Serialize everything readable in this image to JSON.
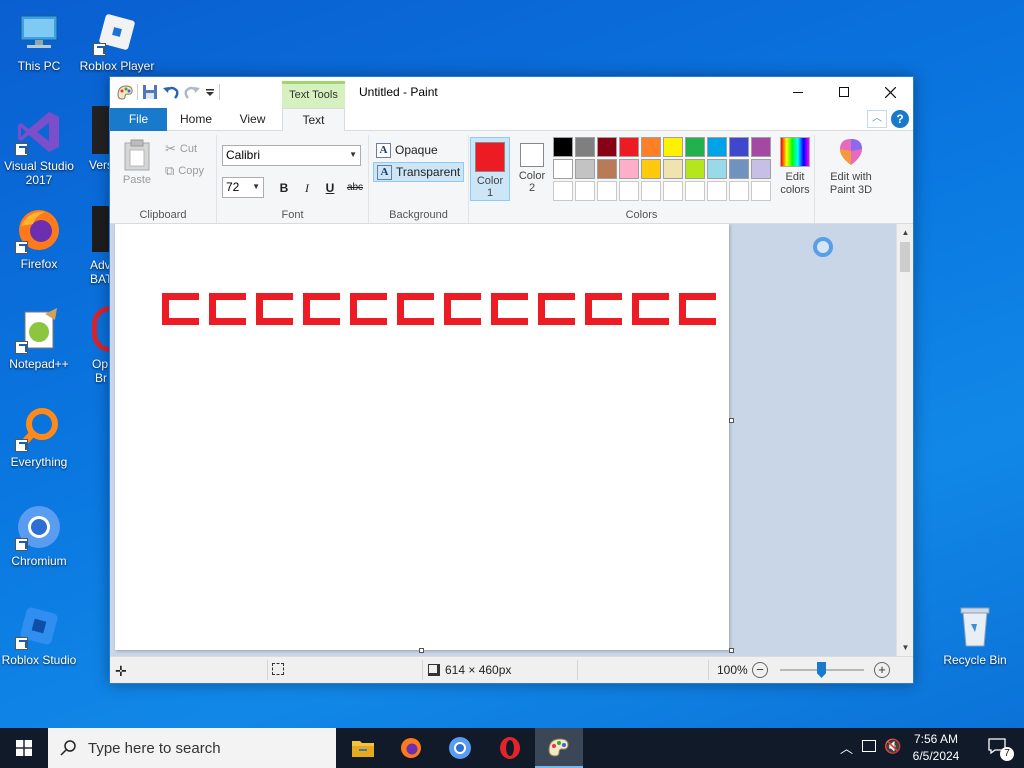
{
  "desktop": {
    "icons": [
      {
        "label": "This PC"
      },
      {
        "label": "Roblox Player"
      },
      {
        "label": "Visual Studio 2017"
      },
      {
        "label": "Firefox"
      },
      {
        "label": "Notepad++"
      },
      {
        "label": "Everything"
      },
      {
        "label": "Chromium"
      },
      {
        "label": "Roblox Studio"
      },
      {
        "label": "Recycle Bin"
      }
    ],
    "partial_labels": [
      "Vers",
      "Adv",
      "BAT",
      "Op",
      "Br"
    ]
  },
  "paint": {
    "title": "Untitled - Paint",
    "context_tab_group": "Text Tools",
    "tabs": {
      "file": "File",
      "home": "Home",
      "view": "View",
      "text": "Text"
    },
    "clipboard": {
      "paste": "Paste",
      "cut": "Cut",
      "copy": "Copy",
      "label": "Clipboard"
    },
    "font": {
      "name": "Calibri",
      "size": "72",
      "bold": "B",
      "italic": "I",
      "underline": "U",
      "strike": "abc",
      "label": "Font"
    },
    "background": {
      "opaque": "Opaque",
      "transparent": "Transparent",
      "label": "Background",
      "selected": "Transparent"
    },
    "colors": {
      "color1_label": "Color\n1",
      "color1_line1": "Color",
      "color1_line2": "1",
      "color2_line1": "Color",
      "color2_line2": "2",
      "color1": "#ed1c24",
      "color2": "#ffffff",
      "palette_row1": [
        "#000000",
        "#7f7f7f",
        "#880015",
        "#ed1c24",
        "#ff7f27",
        "#fff200",
        "#22b14c",
        "#00a2e8",
        "#3f48cc",
        "#a349a4"
      ],
      "palette_row2": [
        "#ffffff",
        "#c3c3c3",
        "#b97a57",
        "#ffaec9",
        "#ffc90e",
        "#efe4b0",
        "#b5e61d",
        "#99d9ea",
        "#7092be",
        "#c8bfe7"
      ],
      "edit_line1": "Edit",
      "edit_line2": "colors",
      "label": "Colors"
    },
    "paint3d": {
      "line1": "Edit with",
      "line2": "Paint 3D"
    },
    "canvas": {
      "text_color": "#ed1c24",
      "glyph_count": 12
    },
    "status": {
      "dimensions": "614 × 460px",
      "zoom": "100%"
    }
  },
  "taskbar": {
    "search_placeholder": "Type here to search",
    "time": "7:56 AM",
    "date": "6/5/2024",
    "notification_count": "7"
  }
}
